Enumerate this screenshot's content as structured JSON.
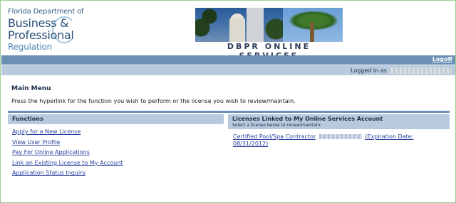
{
  "header": {
    "logo": {
      "line1": "Florida Department of",
      "line2": "Business &",
      "line3": "Professional",
      "line4": "Regulation"
    },
    "services_title": "DBPR ONLINE SERVICES"
  },
  "topbar": {
    "logoff_label": "Logoff"
  },
  "statusbar": {
    "logged_in_label": "Logged in as"
  },
  "main": {
    "title": "Main Menu",
    "description": "Press the hyperlink for the function you wish to perform or the license you wish to review/maintain."
  },
  "functions": {
    "heading": "Functions",
    "links": [
      "Apply for a New License",
      "View User Profile",
      "Pay For Online Applications",
      "Link an Existing License to My Account",
      "Application Status Inquiry"
    ]
  },
  "licenses": {
    "heading": "Licenses Linked to My Online Services Account",
    "subheading": "Select a license below to renew/maintain:",
    "entry": {
      "type": "Certified Pool/Spa Contractor",
      "expiration": "(Expiration Date: 08/31/2012)"
    }
  }
}
